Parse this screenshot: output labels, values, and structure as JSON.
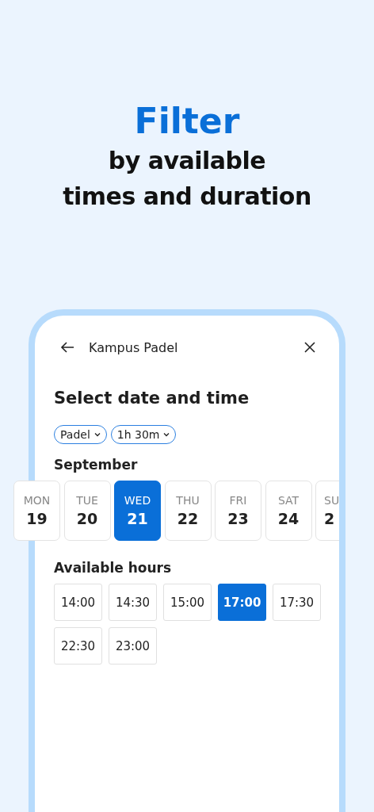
{
  "headline": {
    "accent": "Filter",
    "lines": [
      "by available",
      "times and duration"
    ]
  },
  "header": {
    "title": "Kampus Padel"
  },
  "heading": "Select date and time",
  "filters": [
    {
      "label": "Padel"
    },
    {
      "label": "1h 30m"
    }
  ],
  "month": "September",
  "days": [
    {
      "weekday": "MON",
      "date": "19",
      "selected": false
    },
    {
      "weekday": "TUE",
      "date": "20",
      "selected": false
    },
    {
      "weekday": "WED",
      "date": "21",
      "selected": true
    },
    {
      "weekday": "THU",
      "date": "22",
      "selected": false
    },
    {
      "weekday": "FRI",
      "date": "23",
      "selected": false
    },
    {
      "weekday": "SAT",
      "date": "24",
      "selected": false
    },
    {
      "weekday": "SU",
      "date": "2",
      "selected": false
    }
  ],
  "hours_title": "Available hours",
  "hours": [
    {
      "time": "14:00",
      "selected": false
    },
    {
      "time": "14:30",
      "selected": false
    },
    {
      "time": "15:00",
      "selected": false
    },
    {
      "time": "17:00",
      "selected": true
    },
    {
      "time": "17:30",
      "selected": false
    },
    {
      "time": "22:30",
      "selected": false
    },
    {
      "time": "23:00",
      "selected": false
    }
  ]
}
